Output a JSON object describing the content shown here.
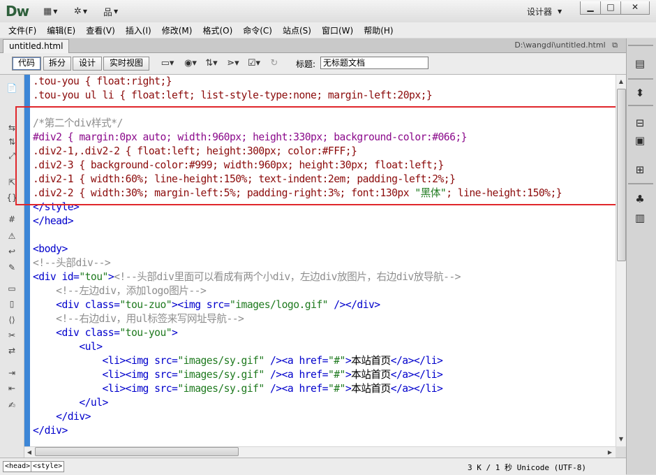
{
  "app": {
    "logo": "Dw",
    "workspace": "设计器",
    "window_controls": [
      "minimize-icon",
      "maximize-icon",
      "close-icon"
    ]
  },
  "title_icons": [
    "layout-icon",
    "gear-icon",
    "site-icon"
  ],
  "menu": [
    "文件(F)",
    "编辑(E)",
    "查看(V)",
    "插入(I)",
    "修改(M)",
    "格式(O)",
    "命令(C)",
    "站点(S)",
    "窗口(W)",
    "帮助(H)"
  ],
  "document": {
    "tab_label": "untitled.html",
    "path": "D:\\wangdi\\untitled.html"
  },
  "toolbar": {
    "views": [
      "代码",
      "拆分",
      "设计",
      "实时视图"
    ],
    "active_view": "代码",
    "icons": [
      "multiscreen-icon",
      "preview-globe-icon",
      "file-management-icon",
      "debug-icon",
      "visual-aids-icon",
      "refresh-icon"
    ],
    "title_label": "标题:",
    "title_value": "无标题文档"
  },
  "code_lines": [
    [
      {
        "t": ".tou-you { float:right;}",
        "c": "c-sel"
      }
    ],
    [
      {
        "t": ".tou-you ul li { float:left; list-style-type:none; margin-left:20px;}",
        "c": "c-sel"
      }
    ],
    [
      {
        "t": "",
        "c": "c-txt"
      }
    ],
    [
      {
        "t": "/*第二个div样式*/",
        "c": "c-com"
      }
    ],
    [
      {
        "t": "#div2 { margin:0px auto; width:960px; height:330px; background-color:#066;}",
        "c": "c-purple"
      }
    ],
    [
      {
        "t": ".div2-1,.div2-2 { float:left; height:300px; color:#FFF;}",
        "c": "c-sel"
      }
    ],
    [
      {
        "t": ".div2-3 { background-color:#999; width:960px; height:30px; float:left;}",
        "c": "c-sel"
      }
    ],
    [
      {
        "t": ".div2-1 { width:60%; line-height:150%; text-indent:2em; padding-left:2%;}",
        "c": "c-sel"
      }
    ],
    [
      {
        "t": ".div2-2 { width:30%; margin-left:5%; padding-right:3%; font:130px ",
        "c": "c-sel"
      },
      {
        "t": "\"黑体\"",
        "c": "c-val"
      },
      {
        "t": "; line-height:150%;}",
        "c": "c-sel"
      }
    ],
    [
      {
        "t": "</style>",
        "c": "c-tag"
      }
    ],
    [
      {
        "t": "</head>",
        "c": "c-tag"
      }
    ],
    [
      {
        "t": "",
        "c": "c-txt"
      }
    ],
    [
      {
        "t": "<body>",
        "c": "c-tag"
      }
    ],
    [
      {
        "t": "<!--头部div-->",
        "c": "c-com"
      }
    ],
    [
      {
        "t": "<div id=",
        "c": "c-tag"
      },
      {
        "t": "\"tou\"",
        "c": "c-val"
      },
      {
        "t": ">",
        "c": "c-tag"
      },
      {
        "t": "<!--头部div里面可以看成有两个小div，左边div放图片，右边div放导航-->",
        "c": "c-com"
      }
    ],
    [
      {
        "t": "    ",
        "c": "c-txt"
      },
      {
        "t": "<!--左边div，添加logo图片-->",
        "c": "c-com"
      }
    ],
    [
      {
        "t": "    <div class=",
        "c": "c-tag"
      },
      {
        "t": "\"tou-zuo\"",
        "c": "c-val"
      },
      {
        "t": "><img src=",
        "c": "c-tag"
      },
      {
        "t": "\"images/logo.gif\"",
        "c": "c-val"
      },
      {
        "t": " /></div>",
        "c": "c-tag"
      }
    ],
    [
      {
        "t": "    ",
        "c": "c-txt"
      },
      {
        "t": "<!--右边div，用ul标签来写网址导航-->",
        "c": "c-com"
      }
    ],
    [
      {
        "t": "    <div class=",
        "c": "c-tag"
      },
      {
        "t": "\"tou-you\"",
        "c": "c-val"
      },
      {
        "t": ">",
        "c": "c-tag"
      }
    ],
    [
      {
        "t": "        <ul>",
        "c": "c-tag"
      }
    ],
    [
      {
        "t": "            <li><img src=",
        "c": "c-tag"
      },
      {
        "t": "\"images/sy.gif\"",
        "c": "c-val"
      },
      {
        "t": " /><a href=",
        "c": "c-tag"
      },
      {
        "t": "\"#\"",
        "c": "c-val"
      },
      {
        "t": ">",
        "c": "c-tag"
      },
      {
        "t": "本站首页",
        "c": "c-txt"
      },
      {
        "t": "</a></li>",
        "c": "c-tag"
      }
    ],
    [
      {
        "t": "            <li><img src=",
        "c": "c-tag"
      },
      {
        "t": "\"images/sy.gif\"",
        "c": "c-val"
      },
      {
        "t": " /><a href=",
        "c": "c-tag"
      },
      {
        "t": "\"#\"",
        "c": "c-val"
      },
      {
        "t": ">",
        "c": "c-tag"
      },
      {
        "t": "本站首页",
        "c": "c-txt"
      },
      {
        "t": "</a></li>",
        "c": "c-tag"
      }
    ],
    [
      {
        "t": "            <li><img src=",
        "c": "c-tag"
      },
      {
        "t": "\"images/sy.gif\"",
        "c": "c-val"
      },
      {
        "t": " /><a href=",
        "c": "c-tag"
      },
      {
        "t": "\"#\"",
        "c": "c-val"
      },
      {
        "t": ">",
        "c": "c-tag"
      },
      {
        "t": "本站首页",
        "c": "c-txt"
      },
      {
        "t": "</a></li>",
        "c": "c-tag"
      }
    ],
    [
      {
        "t": "        </ul>",
        "c": "c-tag"
      }
    ],
    [
      {
        "t": "    </div>",
        "c": "c-tag"
      }
    ],
    [
      {
        "t": "</div>",
        "c": "c-tag"
      }
    ]
  ],
  "left_gutter_icons": [
    "open-documents-icon",
    "collapse-tag-icon",
    "collapse-selection-icon",
    "expand-all-icon",
    "select-parent-icon",
    "balance-braces-icon",
    "line-numbers-icon",
    "highlight-invalid-icon",
    "word-wrap-icon",
    "syntax-coloring-icon",
    "apply-comment-icon",
    "remove-comment-icon",
    "wrap-tag-icon",
    "recent-snippets-icon",
    "move-css-icon",
    "indent-icon",
    "outdent-icon",
    "format-source-icon"
  ],
  "right_panel_icons": [
    "insert-panel-icon",
    "css-styles-icon",
    "ap-elements-icon",
    "files-icon",
    "assets-icon",
    "behaviors-icon",
    "snippets-icon"
  ],
  "status": {
    "breadcrumbs": [
      "<head>",
      "<style>"
    ],
    "text": "3 K / 1 秒 Unicode (UTF-8)"
  },
  "colors": {
    "highlight_box": "#e0272b",
    "code_stripe": "#3d86d6",
    "tag": "#0000cc",
    "css": "#8b0a0a",
    "comment": "#8e8e8e",
    "value": "#1f7a1f"
  }
}
